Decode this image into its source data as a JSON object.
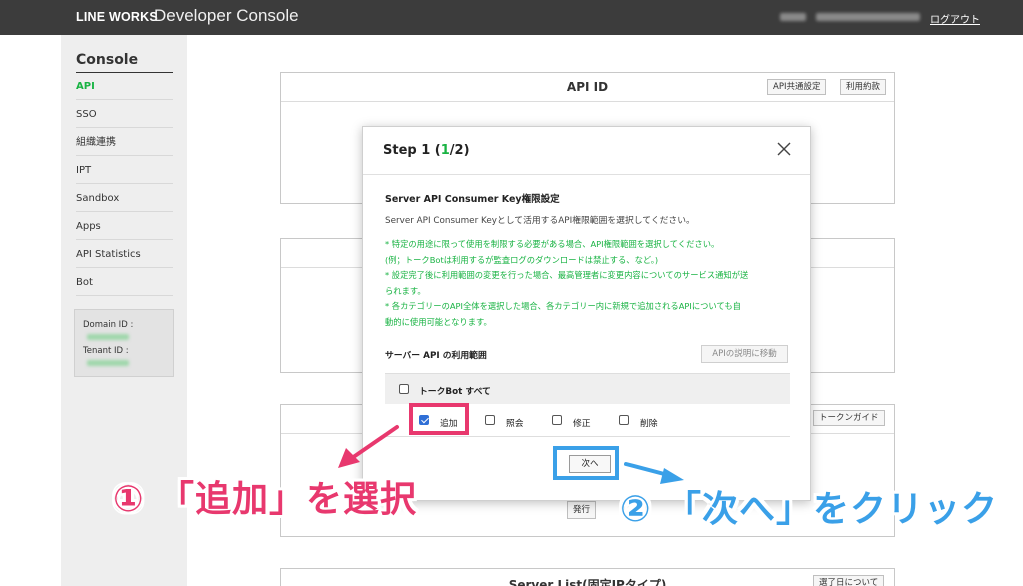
{
  "header": {
    "logo": "LINE WORKS",
    "title": "Developer Console",
    "logout": "ログアウト"
  },
  "sidebar": {
    "title": "Console",
    "items": [
      {
        "label": "API",
        "active": true
      },
      {
        "label": "SSO"
      },
      {
        "label": "組織連携"
      },
      {
        "label": "IPT"
      },
      {
        "label": "Sandbox"
      },
      {
        "label": "Apps"
      },
      {
        "label": "API Statistics"
      },
      {
        "label": "Bot"
      }
    ],
    "domain_label": "Domain ID :",
    "tenant_label": "Tenant ID :"
  },
  "panels": {
    "api_id": {
      "title": "API ID",
      "btn_common": "API共通設定",
      "btn_terms": "利用約款"
    },
    "token_guide": "トークンガイド",
    "issue_button": "発行",
    "server_list": {
      "title": "Server List(固定IPタイプ)",
      "btn": "選了日について"
    }
  },
  "modal": {
    "step_prefix": "Step 1 (",
    "step_current": "1",
    "step_suffix": "/2)",
    "section_title": "Server API Consumer Key権限設定",
    "description": "Server API Consumer Keyとして活用するAPI権限範囲を選択してください。",
    "notes": [
      "* 特定の用途に限って使用を制限する必要がある場合、API権限範囲を選択してください。",
      "(例；トークBotは利用するが監査ログのダウンロードは禁止する、など。)",
      "* 設定完了後に利用範囲の変更を行った場合、最高管理者に変更内容についてのサービス通知が送",
      "られます。",
      "* 各カテゴリーのAPI全体を選択した場合、各カテゴリー内に新規で追加されるAPIについても自",
      "動的に使用可能となります。"
    ],
    "scope_label": "サーバー API の利用範囲",
    "api_desc_button": "APIの説明に移動",
    "group_label": "トークBot すべて",
    "perms": [
      {
        "label": "追加",
        "checked": true
      },
      {
        "label": "照会",
        "checked": false
      },
      {
        "label": "修正",
        "checked": false
      },
      {
        "label": "削除",
        "checked": false
      }
    ],
    "next_button": "次へ"
  },
  "annotations": {
    "pink_text": "① 「追加」を選択",
    "blue_text": "② 「次へ」をクリック",
    "pink_color": "#e8386e",
    "blue_color": "#3aa0e8"
  },
  "colors": {
    "header_bg": "#3c3c3c",
    "accent_green": "#19b343",
    "sidebar_bg": "#eeeeee"
  }
}
